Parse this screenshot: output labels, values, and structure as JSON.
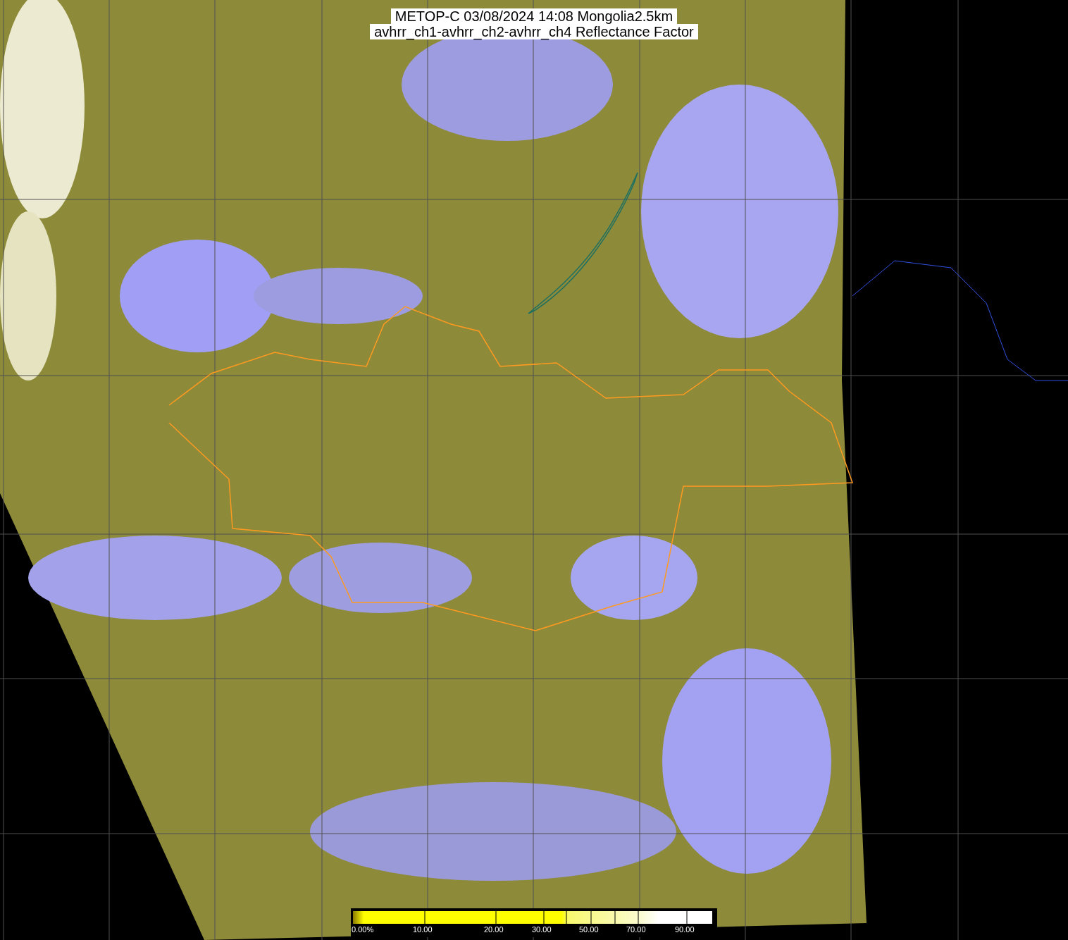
{
  "title": {
    "lines": [
      "METOP-C 03/08/2024 14:08 Mongolia2.5km",
      "avhrr_ch1-avhrr_ch2-avhrr_ch4 Reflectance Factor"
    ]
  },
  "colorbar": {
    "labels": [
      "0.00%",
      "10.00",
      "20.00",
      "30.00",
      "50.00",
      "70.00",
      "90.00"
    ]
  }
}
